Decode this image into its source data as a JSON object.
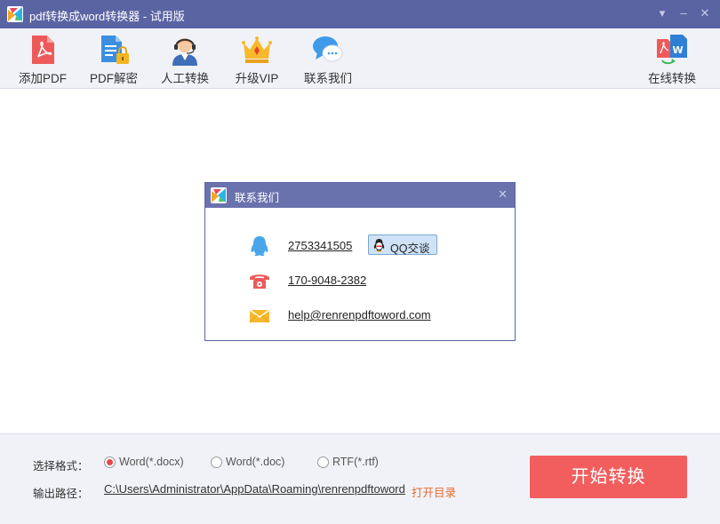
{
  "window": {
    "title": "pdf转换成word转换器 - 试用版",
    "logo_icon": "app-logo-icon",
    "buttons": {
      "menu": "▾",
      "minimize": "–",
      "close": "✕"
    }
  },
  "toolbar": {
    "items": [
      {
        "label": "添加PDF",
        "icon": "pdf-file-icon"
      },
      {
        "label": "PDF解密",
        "icon": "pdf-unlock-icon"
      },
      {
        "label": "人工转换",
        "icon": "support-agent-icon"
      },
      {
        "label": "升级VIP",
        "icon": "crown-icon"
      },
      {
        "label": "联系我们",
        "icon": "chat-bubble-icon"
      }
    ],
    "right_item": {
      "label": "在线转换",
      "icon": "pdf-to-word-icon"
    }
  },
  "dialog": {
    "title": "联系我们",
    "close": "✕",
    "contacts": {
      "qq": "2753341505",
      "phone": "170-9048-2382",
      "email": "help@renrenpdftoword.com"
    },
    "qq_button": "QQ交谈"
  },
  "bottom": {
    "format_label": "选择格式：",
    "formats": [
      {
        "label": "Word(*.docx)",
        "selected": true
      },
      {
        "label": "Word(*.doc)",
        "selected": false
      },
      {
        "label": "RTF(*.rtf)",
        "selected": false
      }
    ],
    "output_label": "输出路径：",
    "output_path": "C:\\Users\\Administrator\\AppData\\Roaming\\renrenpdftoword",
    "open_dir": "打开目录",
    "start_button": "开始转换"
  },
  "colors": {
    "titlebar": "#5b64a3",
    "dialog_header": "#6a72ad",
    "toolbar_bg": "#f1f2f8",
    "start_button": "#f25e5e",
    "link_orange": "#e46a2e",
    "radio_selected": "#e9474b"
  }
}
